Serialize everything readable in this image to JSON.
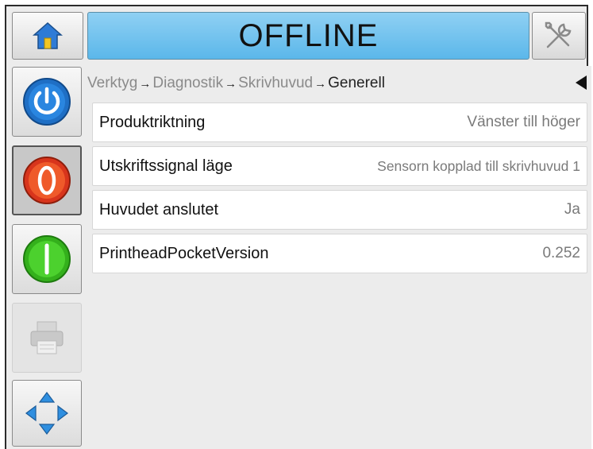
{
  "header": {
    "status": "OFFLINE",
    "home_icon": "home-icon",
    "tools_icon": "tools-icon"
  },
  "sidebar": {
    "items": [
      {
        "name": "power-button",
        "icon": "power-icon",
        "color": "#1f6fc5"
      },
      {
        "name": "stop-button",
        "icon": "stop-icon",
        "color": "#e2401f"
      },
      {
        "name": "start-button",
        "icon": "start-icon",
        "color": "#3bbf1e"
      },
      {
        "name": "print-button",
        "icon": "printer-icon",
        "state": "disabled"
      },
      {
        "name": "navigate-button",
        "icon": "navigation-arrows-icon",
        "color": "#2f8fe0"
      }
    ]
  },
  "breadcrumb": {
    "items": [
      "Verktyg",
      "Diagnostik",
      "Skrivhuvud",
      "Generell"
    ],
    "separator": "→"
  },
  "rows": [
    {
      "label": "Produktriktning",
      "value": "Vänster till höger"
    },
    {
      "label": "Utskriftssignal läge",
      "value": "Sensorn kopplad till skrivhuvud 1"
    },
    {
      "label": "Huvudet anslutet",
      "value": "Ja"
    },
    {
      "label": "PrintheadPocketVersion",
      "value": "0.252"
    }
  ]
}
